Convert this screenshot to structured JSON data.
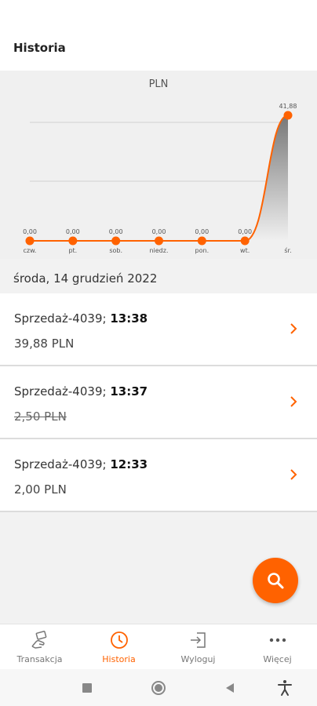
{
  "header": {
    "title": "Historia"
  },
  "chart_data": {
    "type": "area",
    "title": "PLN",
    "categories": [
      "czw.",
      "pt.",
      "sob.",
      "niedz.",
      "pon.",
      "wt.",
      "śr."
    ],
    "values": [
      0.0,
      0.0,
      0.0,
      0.0,
      0.0,
      0.0,
      41.88
    ],
    "value_labels": [
      "0,00",
      "0,00",
      "0,00",
      "0,00",
      "0,00",
      "0,00",
      "41,88"
    ],
    "grid": true,
    "colors": {
      "line": "#ff6200",
      "point": "#ff6200",
      "fill_top": "#777777",
      "fill_bottom": "#f0f0f0"
    }
  },
  "date_header": "środa, 14 grudzień 2022",
  "transactions": [
    {
      "name": "Sprzedaż-4039;",
      "time": "13:38",
      "amount": "39,88 PLN",
      "struck": false
    },
    {
      "name": "Sprzedaż-4039;",
      "time": "13:37",
      "amount": "2,50 PLN",
      "struck": true
    },
    {
      "name": "Sprzedaż-4039;",
      "time": "12:33",
      "amount": "2,00 PLN",
      "struck": false
    }
  ],
  "fab": {
    "icon": "search-icon",
    "color": "#ff6200"
  },
  "bottom_nav": [
    {
      "label": "Transakcja",
      "icon": "hand-payment-icon",
      "active": false
    },
    {
      "label": "Historia",
      "icon": "clock-icon",
      "active": true
    },
    {
      "label": "Wyloguj",
      "icon": "logout-icon",
      "active": false
    },
    {
      "label": "Więcej",
      "icon": "more-dots-icon",
      "active": false
    }
  ],
  "system_nav": [
    {
      "icon": "recent-apps-icon"
    },
    {
      "icon": "home-icon"
    },
    {
      "icon": "back-icon"
    },
    {
      "icon": "accessibility-icon"
    }
  ],
  "accent": "#ff6200"
}
